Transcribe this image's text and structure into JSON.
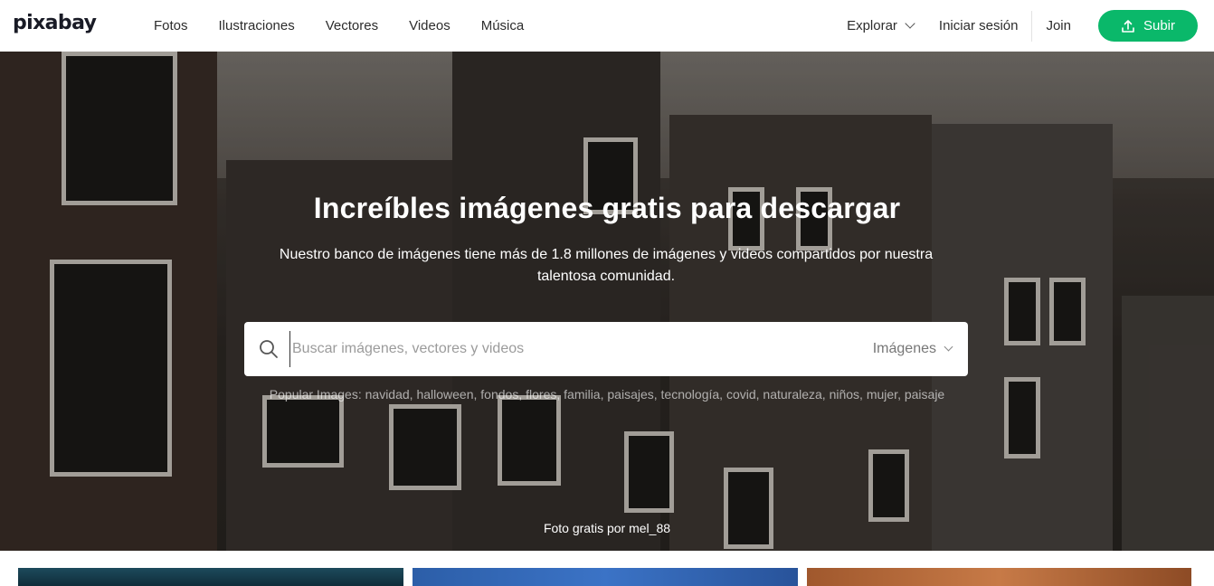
{
  "brand": {
    "logo_text": "pixabay"
  },
  "nav": {
    "links": [
      "Fotos",
      "Ilustraciones",
      "Vectores",
      "Videos",
      "Música"
    ],
    "explore_label": "Explorar",
    "login_label": "Iniciar sesión",
    "join_label": "Join",
    "upload_label": "Subir"
  },
  "hero": {
    "title": "Increíbles imágenes gratis para descargar",
    "subtitle": "Nuestro banco de imágenes tiene más de 1.8 millones de imágenes y videos compartidos por nuestra talentosa comunidad.",
    "search": {
      "placeholder": "Buscar imágenes, vectores y videos",
      "value": "",
      "media_type": "Imágenes"
    },
    "popular_label": "Popular Images:",
    "popular_tags": [
      "navidad",
      "halloween",
      "fondos",
      "flores",
      "familia",
      "paisajes",
      "tecnología",
      "covid",
      "naturaleza",
      "niños",
      "mujer",
      "paisaje"
    ],
    "credit_prefix": "Foto gratis por",
    "credit_author": "mel_88"
  },
  "colors": {
    "accent": "#0ab86a",
    "text": "#2c2c2c"
  }
}
